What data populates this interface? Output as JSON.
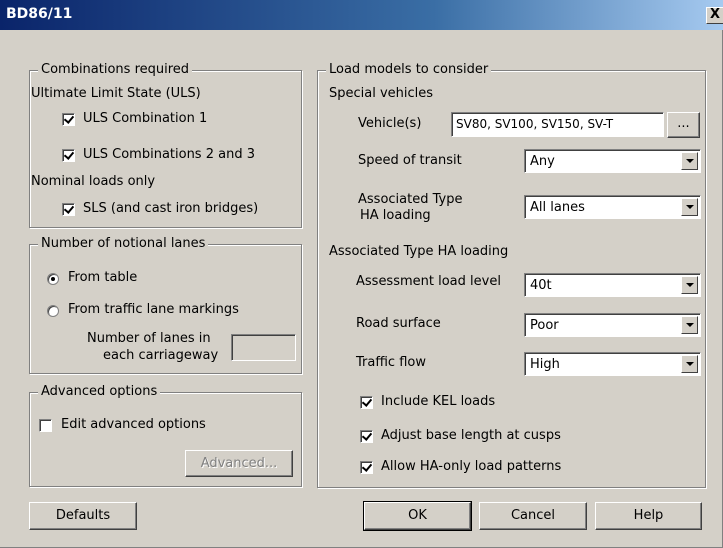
{
  "window": {
    "title": "BD86/11",
    "close_label": "X"
  },
  "combinations": {
    "legend": "Combinations required",
    "uls_heading": "Ultimate Limit State (ULS)",
    "uls1": {
      "label": "ULS Combination 1",
      "checked": true
    },
    "uls23": {
      "label": "ULS Combinations 2 and 3",
      "checked": true
    },
    "nominal_heading": "Nominal loads only",
    "sls": {
      "label": "SLS (and cast iron bridges)",
      "checked": true
    }
  },
  "lanes": {
    "legend": "Number of notional lanes",
    "from_table": {
      "label": "From table",
      "selected": true
    },
    "from_markings": {
      "label": "From traffic lane markings",
      "selected": false
    },
    "count_label_line1": "Number of lanes in",
    "count_label_line2": "each carriageway",
    "count_value": ""
  },
  "advanced": {
    "legend": "Advanced options",
    "edit": {
      "label": "Edit advanced options",
      "checked": false
    },
    "button_label": "Advanced..."
  },
  "load_models": {
    "legend": "Load models to consider",
    "special_heading": "Special vehicles",
    "vehicles_label": "Vehicle(s)",
    "vehicles_value": "SV80, SV100, SV150, SV-T",
    "vehicles_browse": "...",
    "speed_label": "Speed of transit",
    "speed_value": "Any",
    "assoc_label_line1": "Associated Type",
    "assoc_label_line2": "HA loading",
    "assoc_value": "All lanes",
    "ha_heading": "Associated Type HA loading",
    "assessment_label": "Assessment load level",
    "assessment_value": "40t",
    "road_label": "Road surface",
    "road_value": "Poor",
    "traffic_label": "Traffic flow",
    "traffic_value": "High",
    "kel": {
      "label": "Include KEL loads",
      "checked": true
    },
    "cusps": {
      "label": "Adjust base length at cusps",
      "checked": true
    },
    "ha_only": {
      "label": "Allow HA-only load patterns",
      "checked": true
    }
  },
  "buttons": {
    "defaults": "Defaults",
    "ok": "OK",
    "cancel": "Cancel",
    "help": "Help"
  }
}
